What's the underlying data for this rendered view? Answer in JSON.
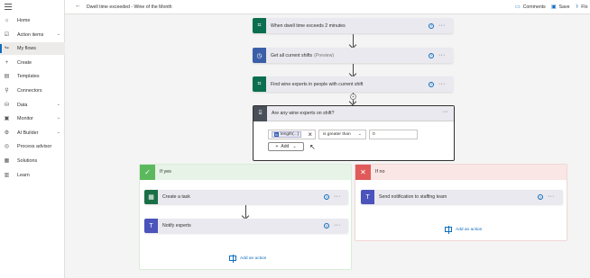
{
  "sidebar": {
    "items": [
      {
        "label": "Home",
        "icon": "home-icon",
        "glyph": "⌂",
        "chevron": false,
        "active": false
      },
      {
        "label": "Action items",
        "icon": "clipboard-icon",
        "glyph": "☑",
        "chevron": true,
        "active": false
      },
      {
        "label": "My flows",
        "icon": "flow-icon",
        "glyph": "↬",
        "chevron": false,
        "active": true
      },
      {
        "label": "Create",
        "icon": "plus-icon",
        "glyph": "+",
        "chevron": false,
        "active": false
      },
      {
        "label": "Templates",
        "icon": "templates-icon",
        "glyph": "▤",
        "chevron": false,
        "active": false
      },
      {
        "label": "Connectors",
        "icon": "connector-icon",
        "glyph": "⚲",
        "chevron": false,
        "active": false
      },
      {
        "label": "Data",
        "icon": "database-icon",
        "glyph": "⛁",
        "chevron": true,
        "active": false
      },
      {
        "label": "Monitor",
        "icon": "monitor-icon",
        "glyph": "▣",
        "chevron": true,
        "active": false
      },
      {
        "label": "AI Builder",
        "icon": "ai-builder-icon",
        "glyph": "⚙",
        "chevron": true,
        "active": false
      },
      {
        "label": "Process advisor",
        "icon": "process-advisor-icon",
        "glyph": "◎",
        "chevron": false,
        "active": false
      },
      {
        "label": "Solutions",
        "icon": "solutions-icon",
        "glyph": "▦",
        "chevron": false,
        "active": false
      },
      {
        "label": "Learn",
        "icon": "book-icon",
        "glyph": "▥",
        "chevron": false,
        "active": false
      }
    ]
  },
  "topbar": {
    "title": "Dwell time exceeded - Wine of the Month",
    "comments_label": "Comments",
    "save_label": "Save",
    "flow_checker_label": "Flo"
  },
  "flow": {
    "trigger": {
      "label": "When dwell time exceeds 2 minutes",
      "color": "#0b6e4f",
      "icon": "shifts-icon",
      "glyph": "⌗"
    },
    "step2": {
      "label": "Get all current shifts",
      "sub": "(Preview)",
      "color": "#3a5fa8",
      "icon": "clock-icon",
      "glyph": "◷"
    },
    "step3": {
      "label": "Find wine experts in people with current shift",
      "color": "#0b6e4f",
      "icon": "shifts-icon",
      "glyph": "⌗"
    },
    "condition": {
      "label": "Are any wine experts on shift?",
      "token": "length(...)",
      "operator": "is greater than",
      "value": "0",
      "add_label": "Add"
    },
    "if_yes": {
      "label": "If yes",
      "color": "#5cb85c",
      "actions": [
        {
          "label": "Create a task",
          "color": "#1b6f46",
          "icon": "planner-icon",
          "glyph": "▦"
        },
        {
          "label": "Notify experts",
          "color": "#4b53bc",
          "icon": "teams-icon",
          "glyph": "T"
        }
      ],
      "add_action": "Add an action"
    },
    "if_no": {
      "label": "If no",
      "color": "#e05a5a",
      "actions": [
        {
          "label": "Send notification to staffing team",
          "color": "#4b53bc",
          "icon": "teams-icon",
          "glyph": "T"
        }
      ],
      "add_action": "Add an action"
    }
  }
}
